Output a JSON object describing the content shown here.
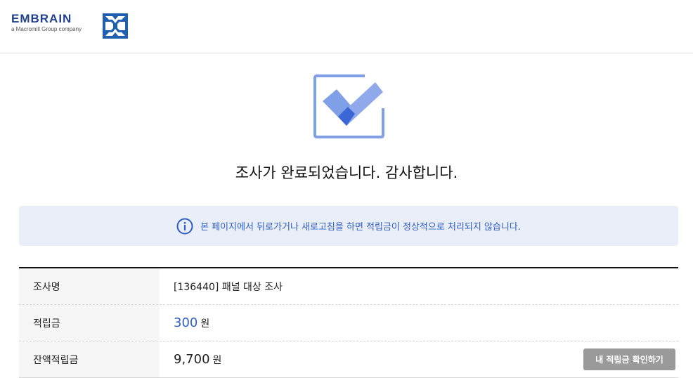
{
  "brand": {
    "name": "EMBRAIN",
    "tagline": "a Macromill Group company"
  },
  "status": {
    "title": "조사가 완료되었습니다. 감사합니다."
  },
  "notice": {
    "icon": "info-icon",
    "text": "본 페이지에서 뒤로가거나 새로고침을 하면 적립금이 정상적으로 처리되지 않습니다."
  },
  "details": {
    "survey": {
      "label": "조사명",
      "value": "[136440] 패널 대상 조사"
    },
    "points": {
      "label": "적립금",
      "value": "300",
      "unit": "원"
    },
    "balance": {
      "label": "잔액적립금",
      "value": "9,700",
      "unit": "원"
    }
  },
  "actions": {
    "check_points_label": "내 적립금 확인하기"
  },
  "colors": {
    "accent": "#2f5fc4",
    "notice_bg": "#e9eef8",
    "check_light": "#7f9fe6",
    "check_dark": "#3a66d6",
    "button_bg": "#9a9a9a"
  }
}
